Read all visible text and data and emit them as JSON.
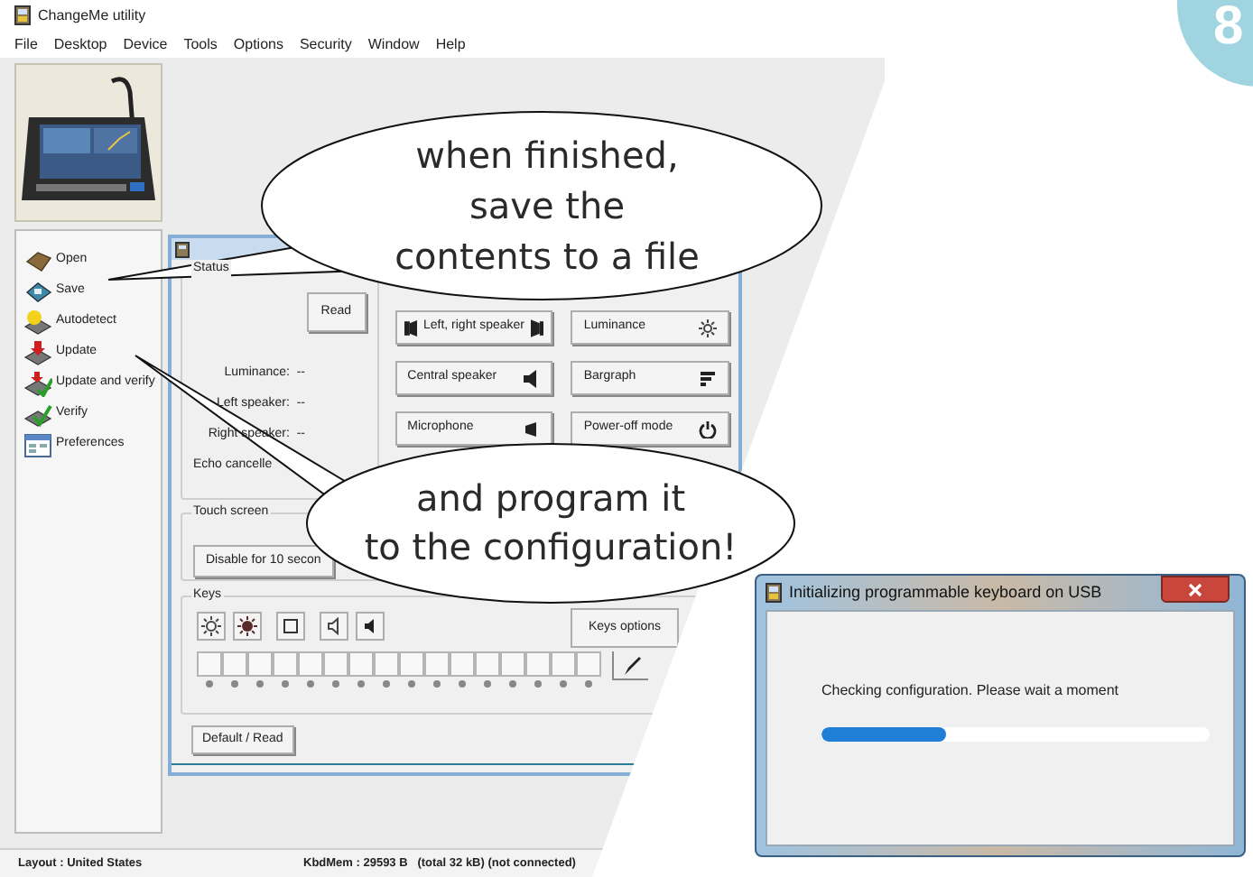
{
  "app": {
    "title": "ChangeMe utility",
    "menu": [
      "File",
      "Desktop",
      "Device",
      "Tools",
      "Options",
      "Security",
      "Window",
      "Help"
    ],
    "sidebar": [
      {
        "label": "Open"
      },
      {
        "label": "Save"
      },
      {
        "label": "Autodetect"
      },
      {
        "label": "Update"
      },
      {
        "label": "Update and verify"
      },
      {
        "label": "Verify"
      },
      {
        "label": "Preferences"
      }
    ],
    "panel": {
      "status": {
        "title": "Status",
        "read_button": "Read",
        "fields": [
          "Luminance:  --",
          "Left speaker:  --",
          "Right speaker:  --",
          "Echo cancelle"
        ]
      },
      "buttons": [
        {
          "label": "Left, right speaker"
        },
        {
          "label": "Luminance"
        },
        {
          "label": "Central speaker"
        },
        {
          "label": "Bargraph"
        },
        {
          "label": "Microphone"
        },
        {
          "label": "Power-off mode"
        }
      ],
      "touch_screen": {
        "title": "Touch screen",
        "button": "Disable for 10 secon"
      },
      "keys": {
        "title": "Keys",
        "options_button": "Keys options"
      },
      "default_button": "Default / Read"
    },
    "status_bar": {
      "layout": "Layout : United States",
      "memory": "KbdMem : 29593 B   (total 32 kB) (not connected)"
    }
  },
  "callouts": [
    "when finished,\nsave the\ncontents to a file",
    "and program it\nto the configuration!"
  ],
  "dialog": {
    "title": "Initializing programmable keyboard on USB",
    "message": "Checking configuration. Please wait a moment",
    "progress": {
      "level": 0.32
    }
  },
  "badge": "8"
}
